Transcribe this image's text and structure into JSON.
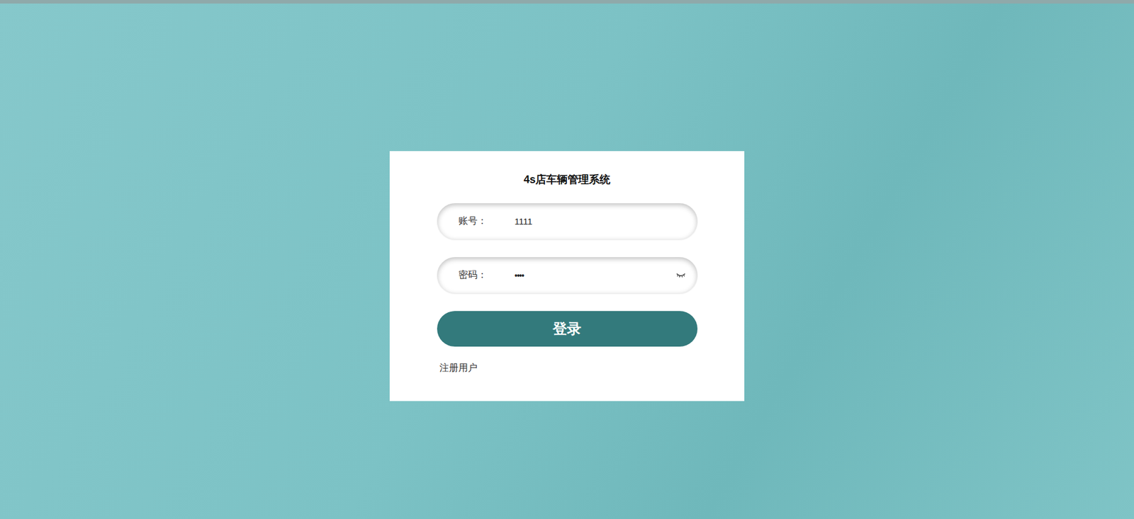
{
  "title": "4s店车辆管理系统",
  "fields": [
    {
      "label": "账号：",
      "value": "1111",
      "kind": "text"
    },
    {
      "label": "密码：",
      "value": "••••",
      "kind": "password"
    }
  ],
  "login_button": "登录",
  "register_link": "注册用户"
}
